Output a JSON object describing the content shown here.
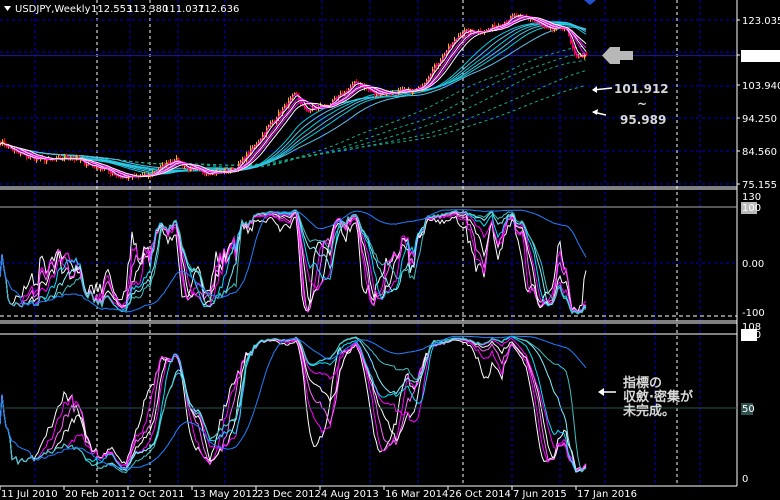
{
  "header": {
    "symbol": "USDJPY,Weekly",
    "open": "112.553",
    "high": "113.380",
    "low": "111.037",
    "close": "112.636"
  },
  "annotations": {
    "upper_value": "101.912",
    "range_mark": "~",
    "lower_value": "95.989",
    "note_line1": "指標の",
    "note_line2": "収斂·密集が",
    "note_line3": "未完成。"
  },
  "colors": {
    "background": "#000000",
    "grid": "#0000c8",
    "bull_candle": "#ffb000",
    "bear_candle": "#ff0000",
    "short_ma": "#ff00ff",
    "long_ma": "#00d0e0",
    "price_line": "#1a1a9a"
  },
  "chart_data": [
    {
      "type": "candlestick",
      "title": "USDJPY,Weekly",
      "ylim": [
        75.155,
        126.5
      ],
      "y_ticks": [
        "123.035",
        "112.636",
        "103.940",
        "94.250",
        "84.560",
        "75.155"
      ],
      "current_price": 112.636,
      "x_ticks": [
        "11 Jul 2010",
        "20 Feb 2011",
        "2 Oct 2011",
        "13 May 2012",
        "23 Dec 2012",
        "4 Aug 2013",
        "16 Mar 2014",
        "26 Oct 2014",
        "7 Jun 2015",
        "17 Jan 2016"
      ],
      "price_keypoints": [
        {
          "month": "2010-07",
          "close": 87.5
        },
        {
          "month": "2010-09",
          "close": 84.0
        },
        {
          "month": "2010-11",
          "close": 82.5
        },
        {
          "month": "2011-01",
          "close": 82.0
        },
        {
          "month": "2011-03",
          "close": 83.0
        },
        {
          "month": "2011-05",
          "close": 81.0
        },
        {
          "month": "2011-07",
          "close": 79.5
        },
        {
          "month": "2011-09",
          "close": 77.0
        },
        {
          "month": "2011-12",
          "close": 77.5
        },
        {
          "month": "2012-03",
          "close": 82.5
        },
        {
          "month": "2012-05",
          "close": 79.0
        },
        {
          "month": "2012-08",
          "close": 78.5
        },
        {
          "month": "2012-10",
          "close": 79.5
        },
        {
          "month": "2012-12",
          "close": 85.5
        },
        {
          "month": "2013-02",
          "close": 92.5
        },
        {
          "month": "2013-05",
          "close": 101.5
        },
        {
          "month": "2013-06",
          "close": 96.5
        },
        {
          "month": "2013-09",
          "close": 98.5
        },
        {
          "month": "2013-12",
          "close": 105.0
        },
        {
          "month": "2014-02",
          "close": 101.5
        },
        {
          "month": "2014-07",
          "close": 102.5
        },
        {
          "month": "2014-09",
          "close": 109.5
        },
        {
          "month": "2014-12",
          "close": 119.5
        },
        {
          "month": "2015-03",
          "close": 120.0
        },
        {
          "month": "2015-06",
          "close": 124.0
        },
        {
          "month": "2015-08",
          "close": 123.5
        },
        {
          "month": "2015-10",
          "close": 120.0
        },
        {
          "month": "2015-12",
          "close": 121.0
        },
        {
          "month": "2016-01",
          "close": 112.636
        }
      ]
    },
    {
      "type": "line",
      "title": "oscillator panel 1",
      "ylim": [
        -100,
        100
      ],
      "y_ticks": [
        "130",
        "100",
        "0.00",
        "-100"
      ]
    },
    {
      "type": "line",
      "title": "oscillator panel 2",
      "ylim": [
        0,
        100
      ],
      "y_ticks": [
        "108",
        "100",
        "50",
        "0"
      ]
    }
  ]
}
